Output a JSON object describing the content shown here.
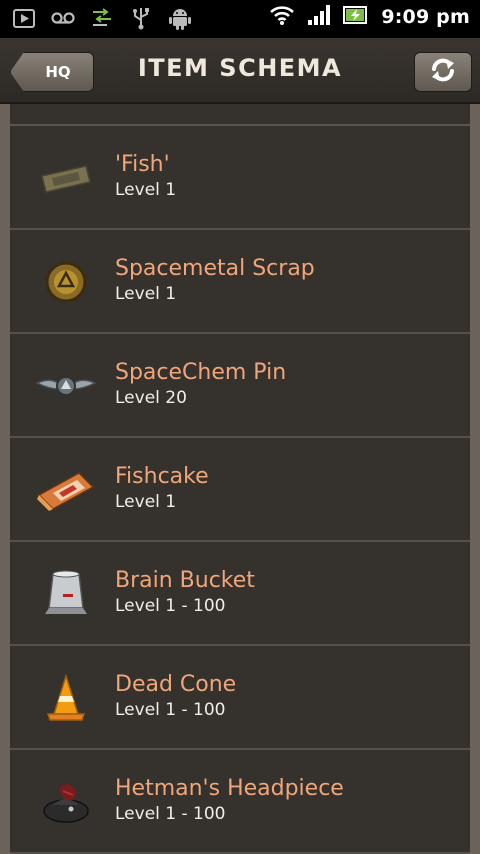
{
  "status_bar": {
    "time": "9:09 pm",
    "icons": [
      "play-store-icon",
      "voicemail-icon",
      "sync-transfer-icon",
      "usb-icon",
      "android-debug-icon",
      "wifi-icon",
      "signal-icon",
      "battery-charging-icon"
    ]
  },
  "header": {
    "back_label": "HQ",
    "title": "ITEM SCHEMA",
    "refresh_icon": "refresh-icon"
  },
  "items": [
    {
      "name": "'Fish'",
      "level": "Level 1",
      "icon": "fish-item-icon"
    },
    {
      "name": "Spacemetal Scrap",
      "level": "Level 1",
      "icon": "spacemetal-scrap-icon"
    },
    {
      "name": "SpaceChem Pin",
      "level": "Level 20",
      "icon": "spacechem-pin-icon"
    },
    {
      "name": "Fishcake",
      "level": "Level 1",
      "icon": "fishcake-icon"
    },
    {
      "name": "Brain Bucket",
      "level": "Level 1 - 100",
      "icon": "brain-bucket-icon"
    },
    {
      "name": "Dead Cone",
      "level": "Level 1 - 100",
      "icon": "dead-cone-icon"
    },
    {
      "name": "Hetman's Headpiece",
      "level": "Level 1 - 100",
      "icon": "hetmans-headpiece-icon"
    }
  ],
  "colors": {
    "item_name": "#f0a67a",
    "item_level": "#f2ede6",
    "list_bg": "#35312d",
    "header_bg": "#2d2925",
    "outer_bg": "#6b625a"
  }
}
